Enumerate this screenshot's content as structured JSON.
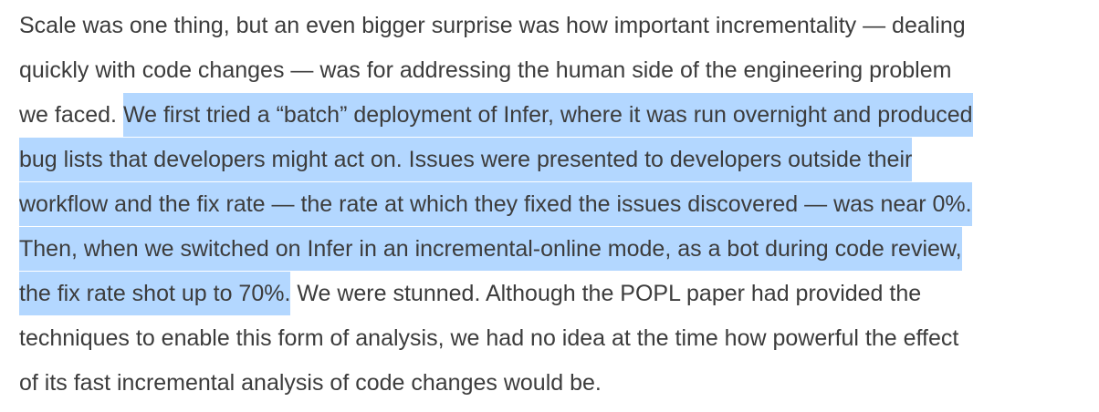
{
  "paragraph": {
    "lines": [
      {
        "plain": "Scale was one thing, but an even bigger surprise was how important incrementality — dealing"
      },
      {
        "plain": "quickly with code changes — was for addressing the human side of the engineering problem"
      },
      {
        "plain": "we faced. ",
        "selected": "We first tried a “batch” deployment of Infer, where it was run overnight and produced"
      },
      {
        "selected": "bug lists that developers might act on. Issues were presented to developers outside their"
      },
      {
        "selected": "workflow and the fix rate — the rate at which they fixed the issues discovered — was near 0%."
      },
      {
        "selected": "Then, when we switched on Infer in an incremental-online mode, as a bot during code review,"
      },
      {
        "selected": "the fix rate shot up to 70%.",
        "after": " We were stunned. Although the POPL paper had provided the"
      },
      {
        "plain": "techniques to enable this form of analysis, we had no idea at the time how powerful the effect"
      },
      {
        "plain": "of its fast incremental analysis of code changes would be."
      }
    ]
  },
  "colors": {
    "text": "#3c3c3c",
    "selection": "#b3d7ff",
    "background": "#ffffff"
  }
}
